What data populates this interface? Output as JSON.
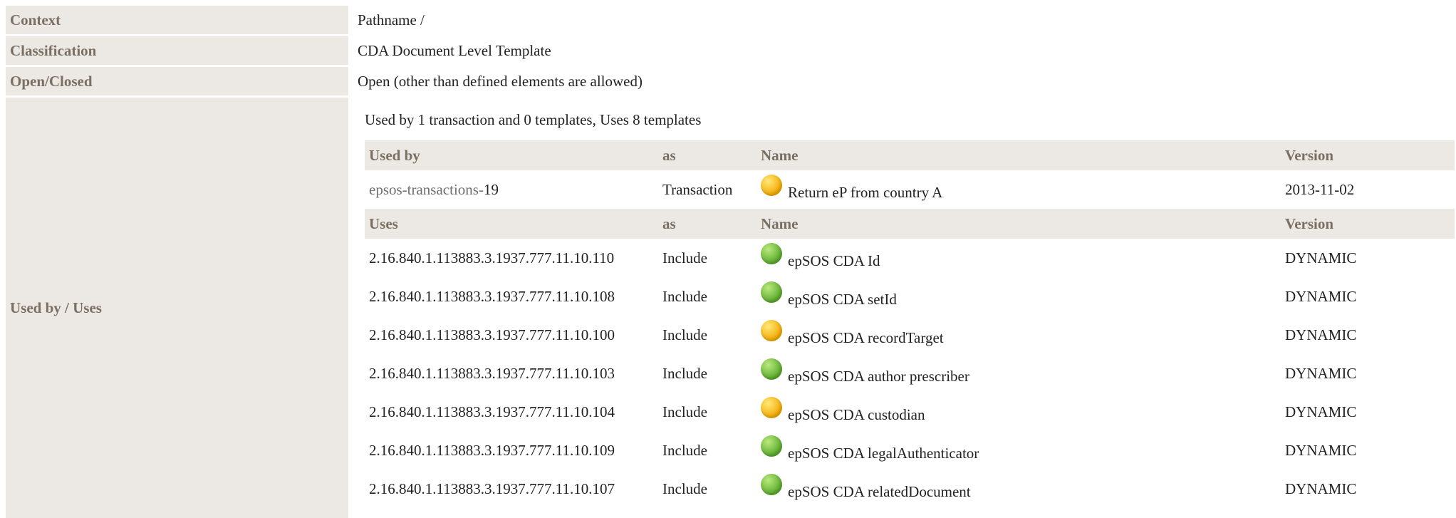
{
  "rows": {
    "context": {
      "label": "Context",
      "value": "Pathname /"
    },
    "classification": {
      "label": "Classification",
      "value": "CDA Document Level Template"
    },
    "open_closed": {
      "label": "Open/Closed",
      "value": "Open (other than defined elements are allowed)"
    },
    "used_by_uses": {
      "label": "Used by / Uses"
    }
  },
  "summary": "Used by 1 transaction and 0 templates, Uses 8 templates",
  "used_by_table": {
    "headers": [
      "Used by",
      "as",
      "Name",
      "Version"
    ],
    "rows": [
      {
        "id_link": "epsos-transactions-",
        "id_num": "19",
        "as": "Transaction",
        "status_color": "yellow",
        "name": "Return eP from country A",
        "version": "2013-11-02"
      }
    ]
  },
  "uses_table": {
    "headers": [
      "Uses",
      "as",
      "Name",
      "Version"
    ],
    "rows": [
      {
        "id": "2.16.840.1.113883.3.1937.777.11.10.110",
        "as": "Include",
        "status_color": "green",
        "name": "epSOS CDA Id",
        "version": "DYNAMIC"
      },
      {
        "id": "2.16.840.1.113883.3.1937.777.11.10.108",
        "as": "Include",
        "status_color": "green",
        "name": "epSOS CDA setId",
        "version": "DYNAMIC"
      },
      {
        "id": "2.16.840.1.113883.3.1937.777.11.10.100",
        "as": "Include",
        "status_color": "yellow",
        "name": "epSOS CDA recordTarget",
        "version": "DYNAMIC"
      },
      {
        "id": "2.16.840.1.113883.3.1937.777.11.10.103",
        "as": "Include",
        "status_color": "green",
        "name": "epSOS CDA author prescriber",
        "version": "DYNAMIC"
      },
      {
        "id": "2.16.840.1.113883.3.1937.777.11.10.104",
        "as": "Include",
        "status_color": "yellow",
        "name": "epSOS CDA custodian",
        "version": "DYNAMIC"
      },
      {
        "id": "2.16.840.1.113883.3.1937.777.11.10.109",
        "as": "Include",
        "status_color": "green",
        "name": "epSOS CDA legalAuthenticator",
        "version": "DYNAMIC"
      },
      {
        "id": "2.16.840.1.113883.3.1937.777.11.10.107",
        "as": "Include",
        "status_color": "green",
        "name": "epSOS CDA relatedDocument",
        "version": "DYNAMIC"
      }
    ]
  }
}
